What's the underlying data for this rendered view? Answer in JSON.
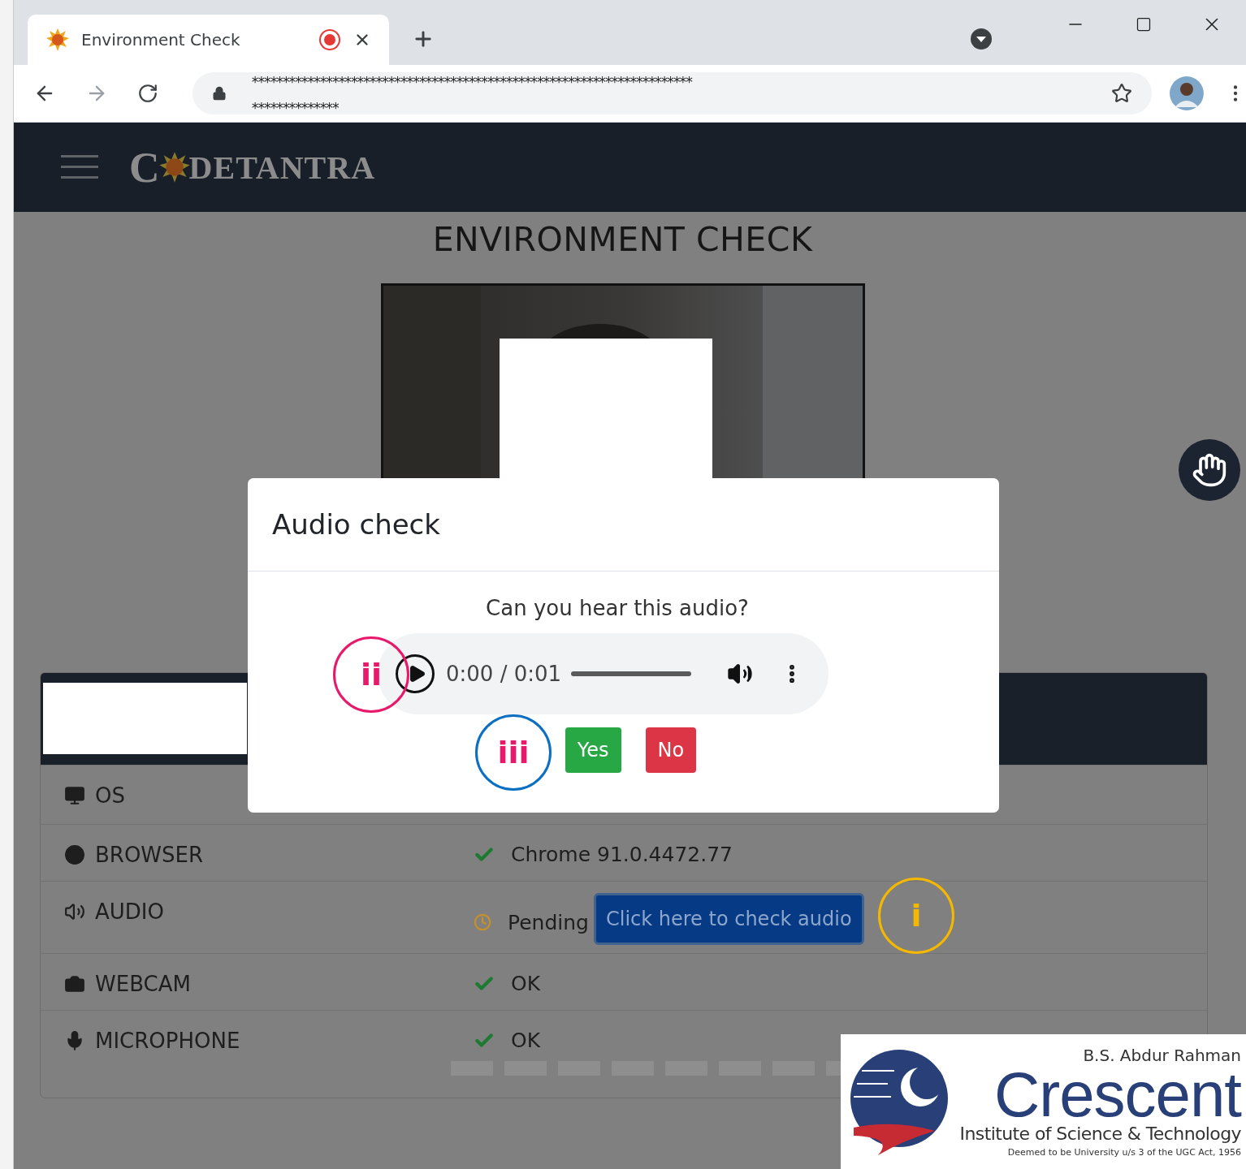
{
  "browser": {
    "tab": {
      "title": "Environment Check",
      "recording": true,
      "selected": true
    },
    "address_lines": [
      "***********************************************************************",
      "**************"
    ]
  },
  "site": {
    "logo": {
      "before": "C",
      "after": "DETANTRA"
    }
  },
  "page_title": "ENVIRONMENT CHECK",
  "checks": [
    {
      "label": "OS"
    },
    {
      "label": "BROWSER",
      "kind": "ok",
      "value": "Chrome 91.0.4472.77"
    },
    {
      "label": "AUDIO",
      "kind": "pending",
      "value": "Pending",
      "action": "Click here to check audio"
    },
    {
      "label": "WEBCAM",
      "kind": "ok",
      "value": "OK"
    },
    {
      "label": "MICROPHONE",
      "kind": "ok",
      "value": "OK",
      "loading": true
    }
  ],
  "dialog": {
    "title": "Audio check",
    "question": "Can you hear this audio?",
    "player": {
      "time": "0:00 / 0:01",
      "level": 0
    },
    "buttons": [
      {
        "label": "Yes",
        "kind": "confirm"
      },
      {
        "label": "No",
        "kind": "deny"
      }
    ]
  },
  "annotations": [
    {
      "color": "#e8196a",
      "label": {
        "text": "ii",
        "color": "#e8196a"
      }
    },
    {
      "color": "#0b6fc2",
      "label": {
        "text": "iii",
        "color": "#e8196a"
      }
    },
    {
      "color": "#f5b800",
      "label": {
        "text": "i",
        "color": "#f5b800"
      }
    }
  ],
  "institution_logo": {
    "lines": [
      "B.S. Abdur Rahman",
      "Crescent",
      "Institute of Science & Technology",
      "Deemed to be University u/s 3 of the UGC Act, 1956"
    ]
  }
}
